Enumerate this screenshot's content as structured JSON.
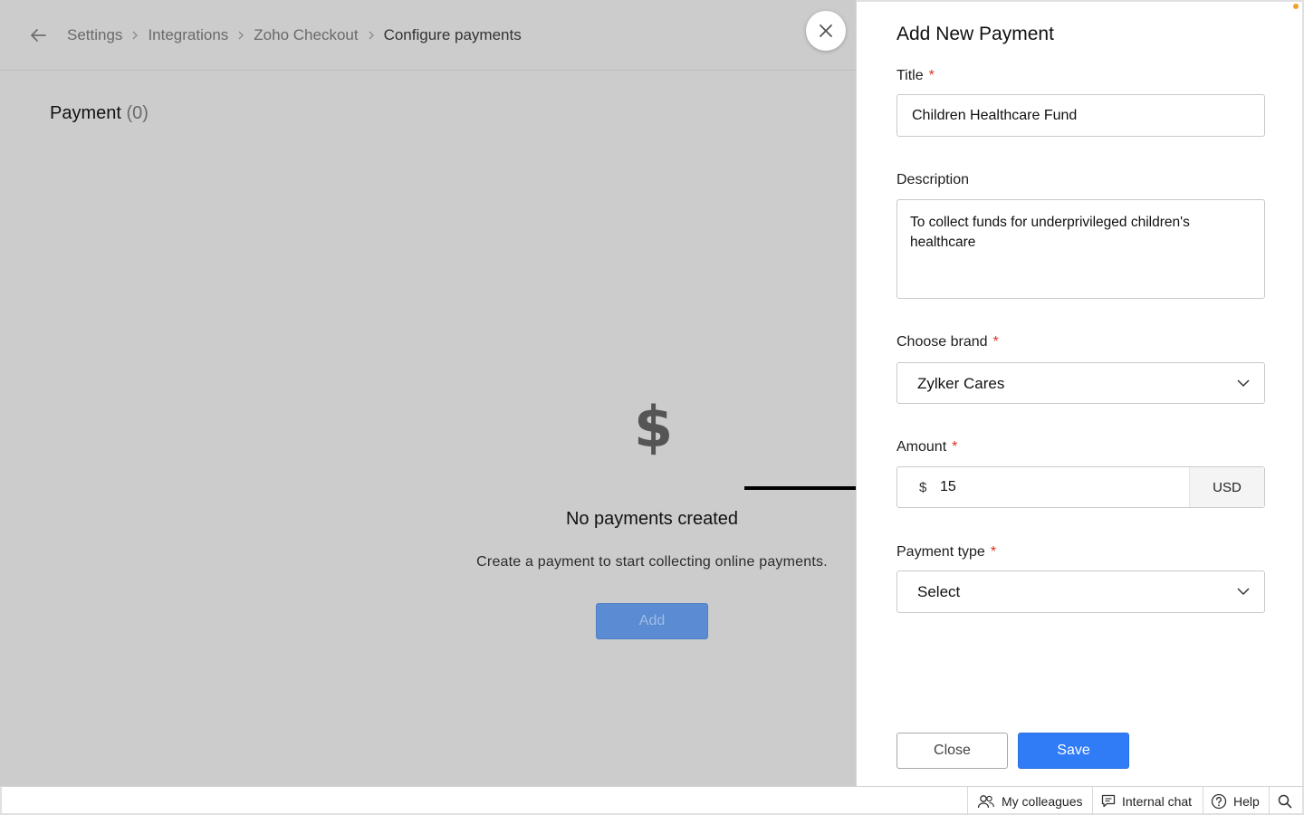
{
  "breadcrumb": {
    "items": [
      "Settings",
      "Integrations",
      "Zoho Checkout",
      "Configure payments"
    ]
  },
  "payment_section": {
    "heading": "Payment",
    "count": "(0)"
  },
  "empty_state": {
    "icon": "$",
    "title": "No payments created",
    "description": "Create a payment to start collecting online payments.",
    "add_label": "Add"
  },
  "panel": {
    "title": "Add New Payment",
    "title_field": {
      "label": "Title",
      "required_mark": "*",
      "value": "Children Healthcare Fund"
    },
    "description_field": {
      "label": "Description",
      "value": "To collect funds for underprivileged children's healthcare"
    },
    "brand_field": {
      "label": "Choose brand",
      "required_mark": "*",
      "value": "Zylker Cares"
    },
    "amount_field": {
      "label": "Amount",
      "required_mark": "*",
      "currency_symbol": "$",
      "value": "15",
      "currency": "USD"
    },
    "payment_type_field": {
      "label": "Payment type",
      "required_mark": "*",
      "value": "Select"
    },
    "close_label": "Close",
    "save_label": "Save"
  },
  "statusbar": {
    "colleagues_label": "My colleagues",
    "chat_label": "Internal chat",
    "help_label": "Help"
  },
  "icons": {
    "back": "arrow-left-icon",
    "separator": "chevron-right-icon",
    "close": "close-icon",
    "dropdown": "chevron-down-icon",
    "colleagues": "people-icon",
    "chat": "chat-icon",
    "help": "help-icon",
    "search": "search-icon"
  },
  "colors": {
    "overlay": "#cccccc",
    "primary": "#2f7cf6",
    "required": "#e0301e",
    "add_disabled": "#5b8bd2"
  }
}
